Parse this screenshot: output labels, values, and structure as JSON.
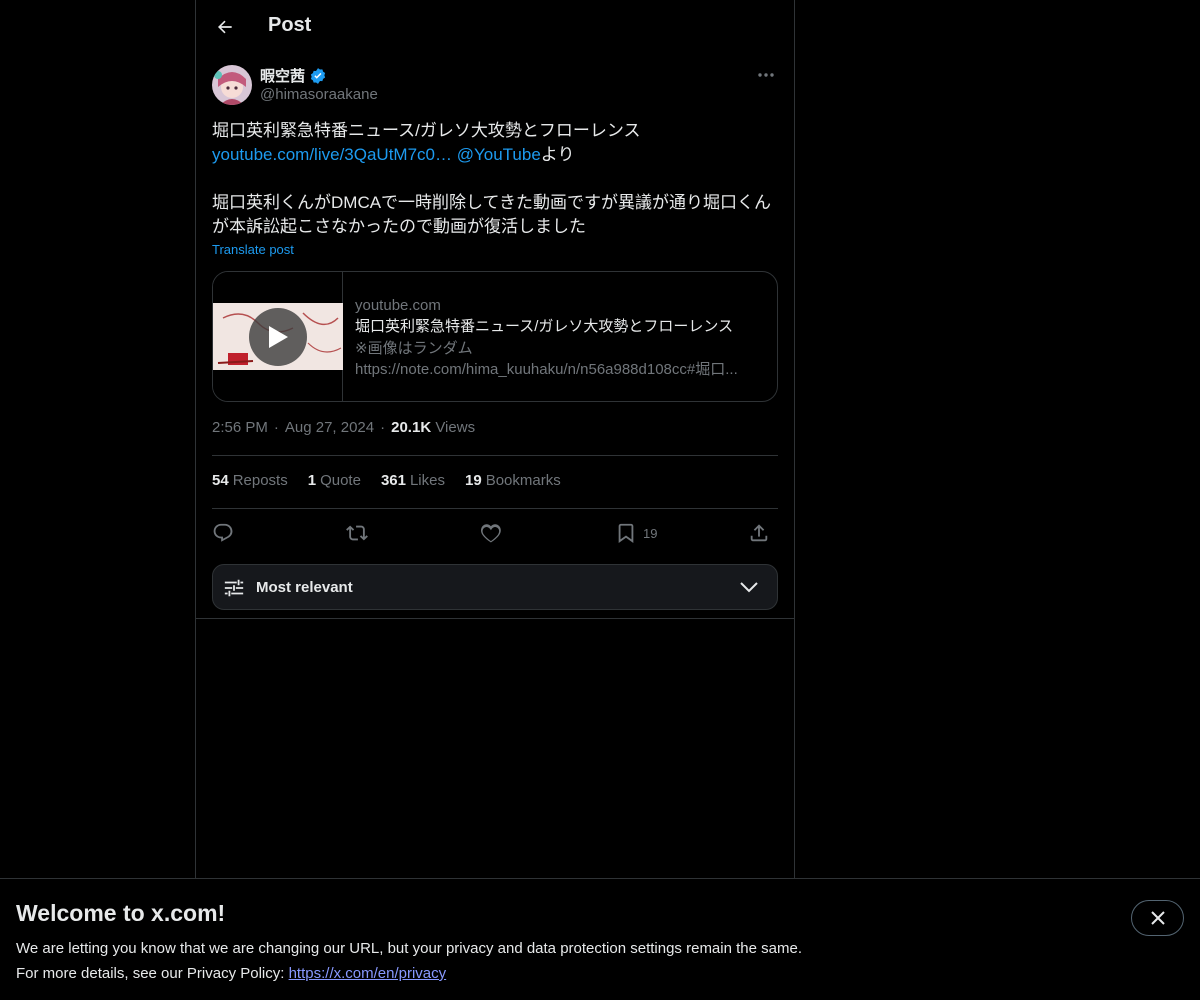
{
  "header": {
    "title": "Post"
  },
  "author": {
    "name": "暇空茜",
    "handle": "@himasoraakane"
  },
  "post": {
    "line1": "堀口英利緊急特番ニュース/ガレソ大攻勢とフローレンス",
    "link_url": "youtube.com/live/3QaUtM7c0…",
    "link_mention": "@YouTube",
    "link_suffix": "より",
    "line3": "堀口英利くんがDMCAで一時削除してきた動画ですが異議が通り堀口くん",
    "line4": "が本訴訟起こさなかったので動画が復活しました",
    "translate": "Translate post"
  },
  "card": {
    "domain": "youtube.com",
    "title": "堀口英利緊急特番ニュース/ガレソ大攻勢とフローレンス",
    "desc1": "※画像はランダム",
    "desc2": "https://note.com/hima_kuuhaku/n/n56a988d108cc#堀口..."
  },
  "meta": {
    "time": "2:56 PM",
    "sep": "·",
    "date": "Aug 27, 2024",
    "views_count": "20.1K",
    "views_label": "Views"
  },
  "stats": [
    {
      "count": "54",
      "label": "Reposts"
    },
    {
      "count": "1",
      "label": "Quote"
    },
    {
      "count": "361",
      "label": "Likes"
    },
    {
      "count": "19",
      "label": "Bookmarks"
    }
  ],
  "actions": {
    "bookmark_count": "19"
  },
  "sort": {
    "label": "Most relevant"
  },
  "banner": {
    "title": "Welcome to x.com!",
    "line1": "We are letting you know that we are changing our URL, but your privacy and data protection settings remain the same.",
    "line2_prefix": "For more details, see our Privacy Policy: ",
    "line2_link": "https://x.com/en/privacy"
  },
  "colors": {
    "accent": "#1d9bf0",
    "verified": "#1d9bf0",
    "background": "#000000",
    "border": "#2f3336",
    "muted": "#71767b"
  }
}
